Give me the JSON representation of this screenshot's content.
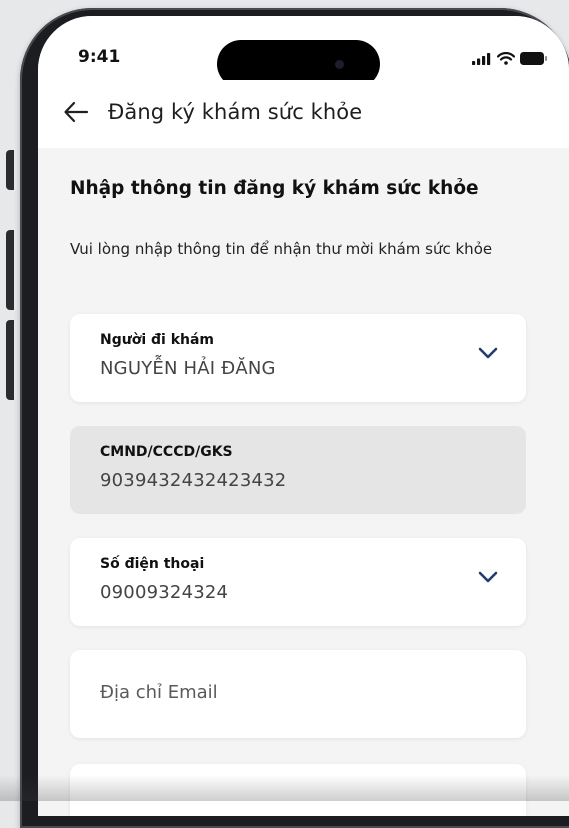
{
  "status_bar": {
    "time": "9:41"
  },
  "header": {
    "title": "Đăng ký khám sức khỏe"
  },
  "form": {
    "title": "Nhập thông tin đăng ký khám sức khỏe",
    "description": "Vui lòng nhập thông tin để nhận thư mời khám sức khỏe",
    "patient": {
      "label": "Người đi khám",
      "value": "NGUYỄN HẢI ĐĂNG"
    },
    "id_number": {
      "label": "CMND/CCCD/GKS",
      "value": "9039432432423432"
    },
    "phone": {
      "label": "Số điện thoại",
      "value": "09009324324"
    },
    "email": {
      "placeholder": "Địa chỉ Email"
    }
  },
  "colors": {
    "screen_bg": "#f4f4f4",
    "disabled_field": "#e5e5e5",
    "chevron": "#1f3d6e"
  }
}
